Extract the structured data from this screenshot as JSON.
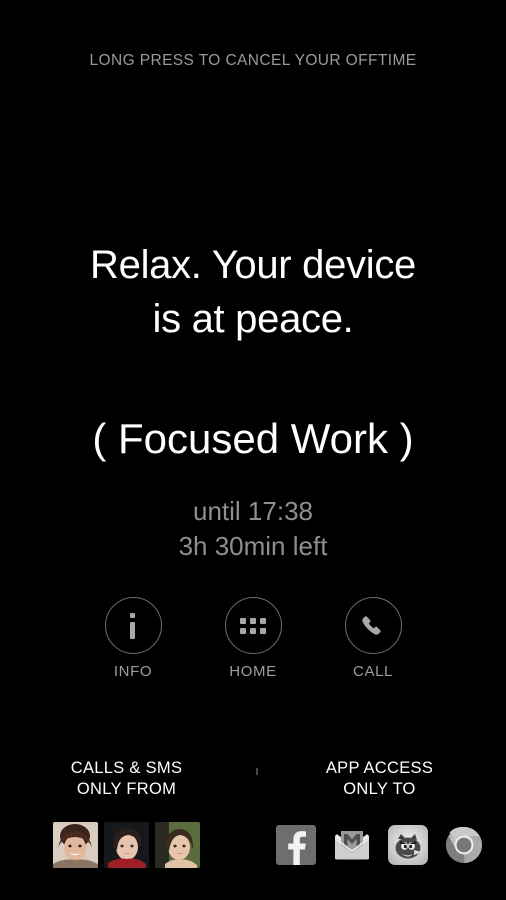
{
  "screen": {
    "background_color": "#000000",
    "hint_text": "LONG PRESS TO CANCEL YOUR OFFTIME"
  },
  "message": {
    "line1": "Relax. Your device",
    "line2": "is at peace."
  },
  "profile": {
    "name": "( Focused Work )"
  },
  "timing": {
    "until": "until 17:38",
    "remaining": "3h 30min left"
  },
  "actions": [
    {
      "label": "INFO",
      "icon": "info-icon"
    },
    {
      "label": "HOME",
      "icon": "app-grid-icon"
    },
    {
      "label": "CALL",
      "icon": "phone-icon"
    }
  ],
  "allowlist": {
    "contacts": {
      "title_line1": "CALLS & SMS",
      "title_line2": "ONLY FROM",
      "avatars": [
        {
          "name": "contact-avatar-1"
        },
        {
          "name": "contact-avatar-2"
        },
        {
          "name": "contact-avatar-3"
        }
      ]
    },
    "apps": {
      "title_line1": "APP ACCESS",
      "title_line2": "ONLY TO",
      "items": [
        {
          "name": "facebook-icon",
          "label": "Facebook"
        },
        {
          "name": "gmail-icon",
          "label": "Gmail"
        },
        {
          "name": "angry-birds-icon",
          "label": "Angry Birds"
        },
        {
          "name": "chrome-icon",
          "label": "Chrome"
        }
      ]
    }
  },
  "colors": {
    "background": "#000000",
    "primary_text": "#ffffff",
    "muted_text": "#8f8f8f",
    "hint_text": "#9a9a9a",
    "icon_stroke": "#6d6d6d",
    "icon_fill": "#a8a8a8"
  }
}
